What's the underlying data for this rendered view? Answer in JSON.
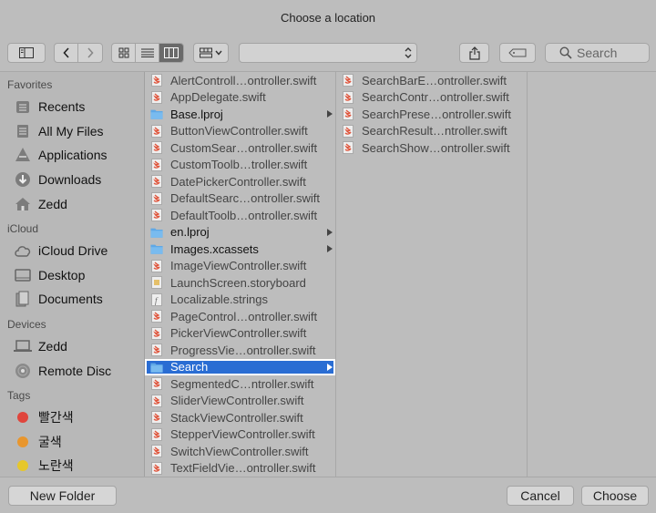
{
  "window": {
    "title": "Choose a location"
  },
  "toolbar": {
    "location_popup_value": "",
    "search_placeholder": "Search"
  },
  "sidebar": {
    "favorites_label": "Favorites",
    "favorites": [
      {
        "label": "Recents",
        "icon": "recents-icon"
      },
      {
        "label": "All My Files",
        "icon": "all-files-icon"
      },
      {
        "label": "Applications",
        "icon": "applications-icon"
      },
      {
        "label": "Downloads",
        "icon": "downloads-icon"
      },
      {
        "label": "Zedd",
        "icon": "home-icon"
      }
    ],
    "icloud_label": "iCloud",
    "icloud": [
      {
        "label": "iCloud Drive",
        "icon": "cloud-icon"
      },
      {
        "label": "Desktop",
        "icon": "desktop-icon"
      },
      {
        "label": "Documents",
        "icon": "documents-icon"
      }
    ],
    "devices_label": "Devices",
    "devices": [
      {
        "label": "Zedd",
        "icon": "laptop-icon"
      },
      {
        "label": "Remote Disc",
        "icon": "disc-icon"
      }
    ],
    "tags_label": "Tags",
    "tags": [
      {
        "label": "빨간색",
        "color": "#e0453c"
      },
      {
        "label": "굴색",
        "color": "#e8962e"
      },
      {
        "label": "노란색",
        "color": "#e6c72b"
      }
    ]
  },
  "column1": {
    "items": [
      {
        "name": "AlertControll…ontroller.swift",
        "kind": "swift"
      },
      {
        "name": "AppDelegate.swift",
        "kind": "swift"
      },
      {
        "name": "Base.lproj",
        "kind": "folder"
      },
      {
        "name": "ButtonViewController.swift",
        "kind": "swift"
      },
      {
        "name": "CustomSear…ontroller.swift",
        "kind": "swift"
      },
      {
        "name": "CustomToolb…troller.swift",
        "kind": "swift"
      },
      {
        "name": "DatePickerController.swift",
        "kind": "swift"
      },
      {
        "name": "DefaultSearc…ontroller.swift",
        "kind": "swift"
      },
      {
        "name": "DefaultToolb…ontroller.swift",
        "kind": "swift"
      },
      {
        "name": "en.lproj",
        "kind": "folder"
      },
      {
        "name": "Images.xcassets",
        "kind": "folder"
      },
      {
        "name": "ImageViewController.swift",
        "kind": "swift"
      },
      {
        "name": "LaunchScreen.storyboard",
        "kind": "storyboard"
      },
      {
        "name": "Localizable.strings",
        "kind": "strings"
      },
      {
        "name": "PageControl…ontroller.swift",
        "kind": "swift"
      },
      {
        "name": "PickerViewController.swift",
        "kind": "swift"
      },
      {
        "name": "ProgressVie…ontroller.swift",
        "kind": "swift"
      },
      {
        "name": "Search",
        "kind": "folder",
        "selected": true
      },
      {
        "name": "SegmentedC…ntroller.swift",
        "kind": "swift"
      },
      {
        "name": "SliderViewController.swift",
        "kind": "swift"
      },
      {
        "name": "StackViewController.swift",
        "kind": "swift"
      },
      {
        "name": "StepperViewController.swift",
        "kind": "swift"
      },
      {
        "name": "SwitchViewController.swift",
        "kind": "swift"
      },
      {
        "name": "TextFieldVie…ontroller.swift",
        "kind": "swift"
      }
    ]
  },
  "column2": {
    "items": [
      {
        "name": "SearchBarE…ontroller.swift",
        "kind": "swift"
      },
      {
        "name": "SearchContr…ontroller.swift",
        "kind": "swift"
      },
      {
        "name": "SearchPrese…ontroller.swift",
        "kind": "swift"
      },
      {
        "name": "SearchResult…ntroller.swift",
        "kind": "swift"
      },
      {
        "name": "SearchShow…ontroller.swift",
        "kind": "swift"
      }
    ]
  },
  "buttons": {
    "new_folder": "New Folder",
    "cancel": "Cancel",
    "choose": "Choose"
  }
}
